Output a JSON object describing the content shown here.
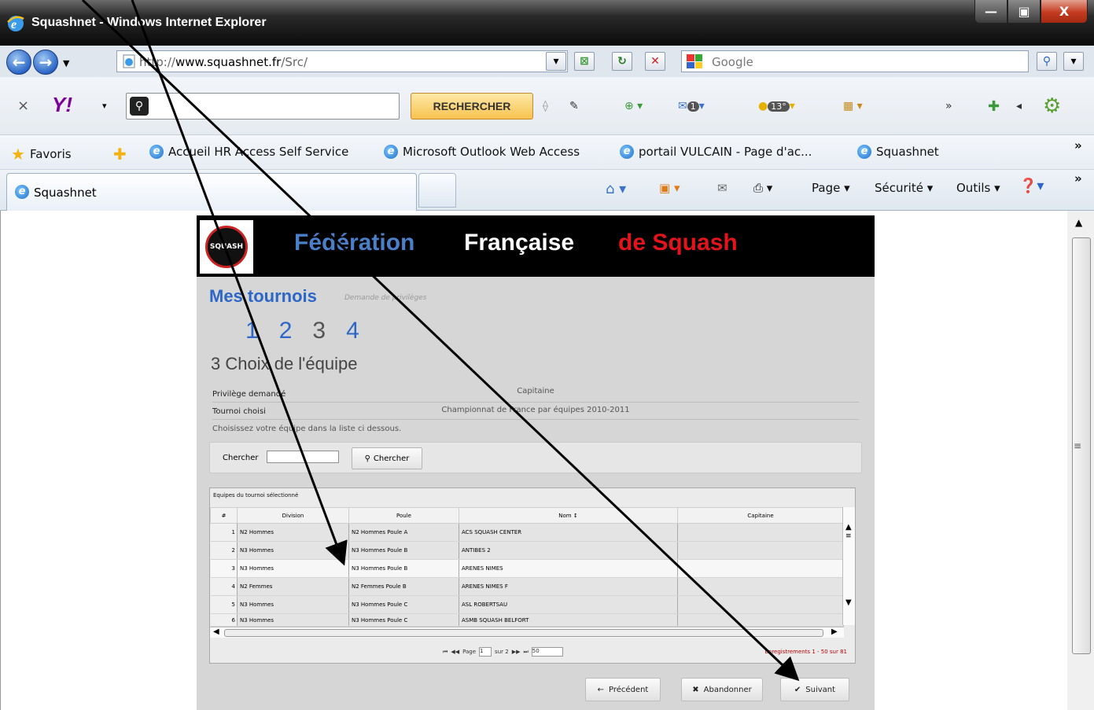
{
  "window": {
    "title": "Squashnet - Windows Internet Explorer",
    "min_label": "—",
    "max_label": "▣",
    "close_label": "X"
  },
  "address": {
    "url_prefix": "http://",
    "url_host": "www.squashnet.fr",
    "url_path": "/Src/",
    "search_placeholder": "Google"
  },
  "yahoo": {
    "close_label": "×",
    "logo": "Y!",
    "search_button": "RECHERCHER",
    "badge_mail": "1",
    "badge_weather": "13°"
  },
  "favorites": {
    "label": "Favoris",
    "items": [
      "Accueil HR Access Self Service",
      "Microsoft Outlook Web Access",
      "portail VULCAIN - Page d'ac...",
      "Squashnet"
    ]
  },
  "tabs": {
    "active_tab": "Squashnet",
    "commands": [
      "Page ▾",
      "Sécurité ▾",
      "Outils ▾"
    ]
  },
  "site": {
    "logo_text": "SQUASH",
    "title_part1": "Fédération",
    "title_part2": "Française",
    "title_part3": "de Squash",
    "section_title": "Mes tournois",
    "section_subtitle": "Demande de privilèges",
    "steps": [
      "1",
      "2",
      "3",
      "4"
    ],
    "step_heading": "3  Choix de l'équipe",
    "privilege_label": "Privilège demandé",
    "privilege_value": "Capitaine",
    "tournoi_label": "Tournoi choisi",
    "tournoi_value": "Championnat de France par équipes 2010-2011",
    "hint": "Choisissez votre équipe dans la liste ci dessous.",
    "search_label": "Chercher",
    "search_button": "Chercher"
  },
  "grid": {
    "caption": "Equipes du tournoi sélectionné",
    "headers": [
      "#",
      "Division",
      "Poule",
      "Nom ↕",
      "Capitaine"
    ],
    "rows": [
      {
        "num": "1",
        "division": "N2 Hommes",
        "poule": "N2 Hommes Poule A",
        "nom": "ACS SQUASH CENTER",
        "capitaine": ""
      },
      {
        "num": "2",
        "division": "N3 Hommes",
        "poule": "N3 Hommes Poule B",
        "nom": "ANTIBES 2",
        "capitaine": ""
      },
      {
        "num": "3",
        "division": "N3 Hommes",
        "poule": "N3 Hommes Poule B",
        "nom": "ARENES NIMES",
        "capitaine": ""
      },
      {
        "num": "4",
        "division": "N2 Femmes",
        "poule": "N2 Femmes Poule B",
        "nom": "ARENES NIMES F",
        "capitaine": ""
      },
      {
        "num": "5",
        "division": "N3 Hommes",
        "poule": "N3 Hommes Poule C",
        "nom": "ASL ROBERTSAU",
        "capitaine": ""
      },
      {
        "num": "6",
        "division": "N3 Hommes",
        "poule": "N3 Hommes Poule C",
        "nom": "ASMB SQUASH BELFORT",
        "capitaine": ""
      }
    ],
    "pager_page_label": "Page",
    "pager_page_value": "1",
    "pager_of": "sur 2",
    "pager_size": "50",
    "records": "Enregistrements 1 - 50 sur 81"
  },
  "actions": {
    "prev": "Précédent",
    "cancel": "Abandonner",
    "next": "Suivant"
  },
  "colors": {
    "brand_blue": "#2c66c7",
    "brand_red": "#e3141b",
    "annotation_arrow": "#000000"
  }
}
